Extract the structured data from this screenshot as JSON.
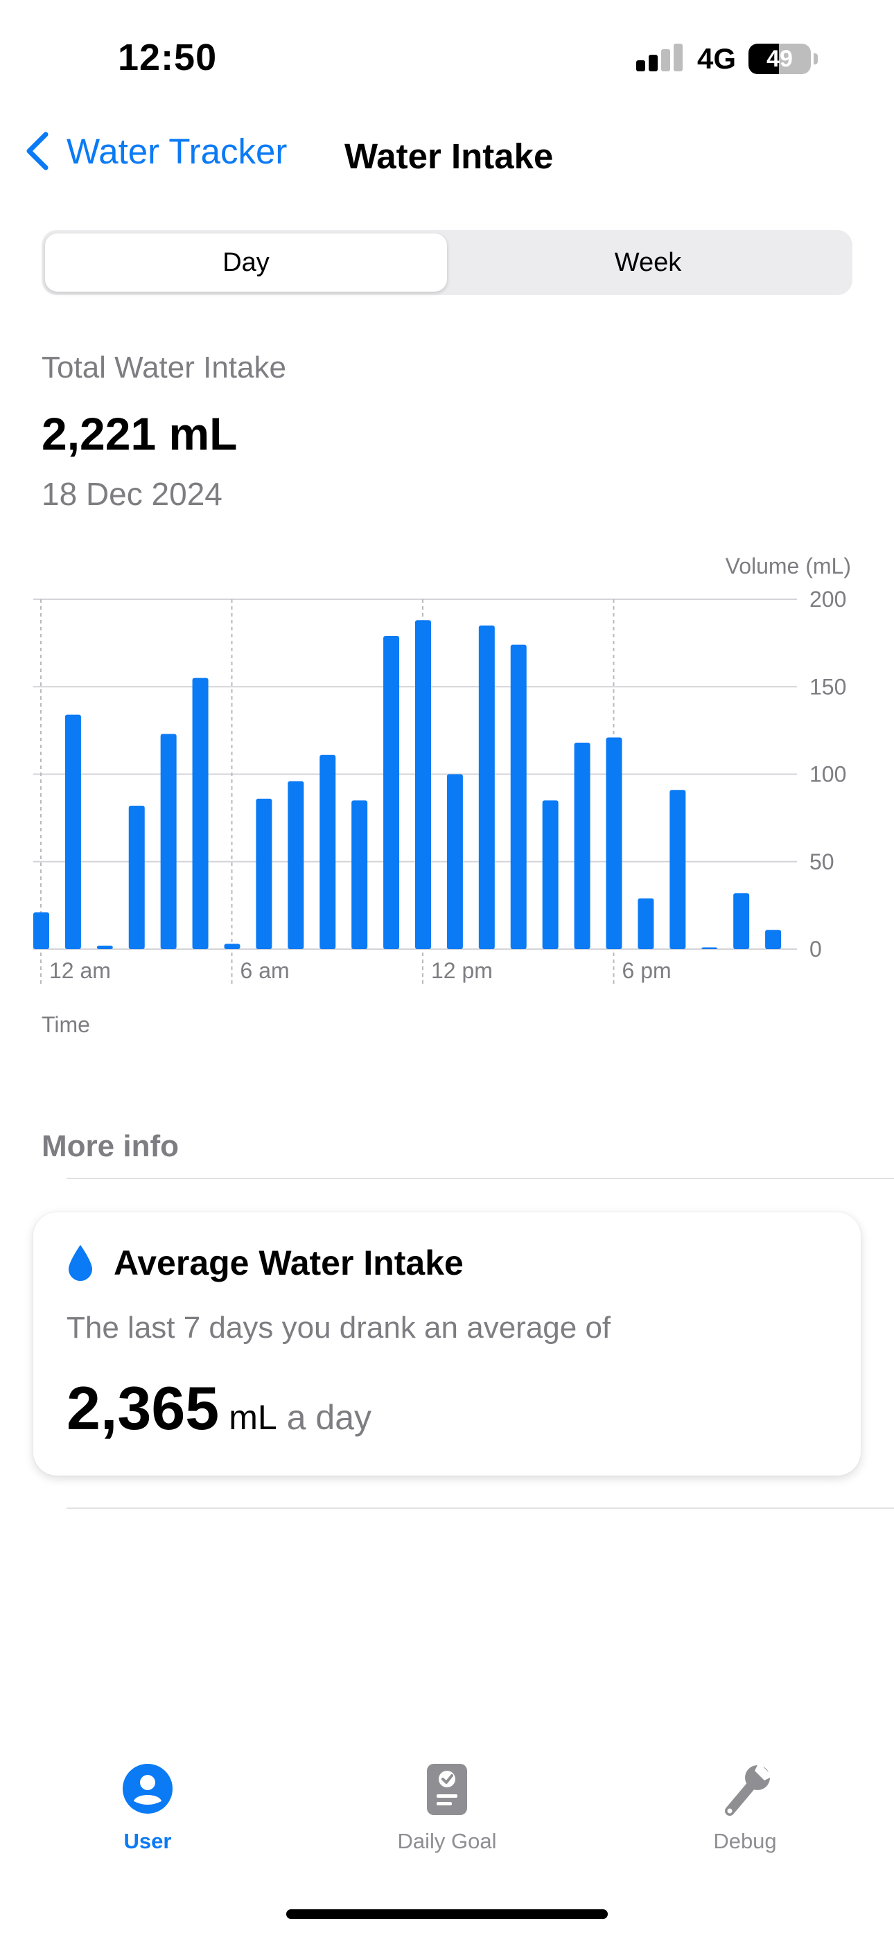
{
  "status_bar": {
    "time": "12:50",
    "network": "4G",
    "battery": "49",
    "battery_level": 0.49
  },
  "nav": {
    "back_label": "Water Tracker",
    "title": "Water Intake"
  },
  "segmented": {
    "options": [
      "Day",
      "Week"
    ],
    "selected": "Day"
  },
  "summary": {
    "label": "Total Water Intake",
    "value": "2,221 mL",
    "date": "18 Dec 2024"
  },
  "chart_data": {
    "type": "bar",
    "ylabel": "Volume (mL)",
    "xlabel": "Time",
    "ylim": [
      0,
      200
    ],
    "yticks": [
      0,
      50,
      100,
      150,
      200
    ],
    "x_tick_labels": [
      "12 am",
      "6 am",
      "12 pm",
      "6 pm"
    ],
    "categories": [
      "0",
      "1",
      "2",
      "3",
      "4",
      "5",
      "6",
      "7",
      "8",
      "9",
      "10",
      "11",
      "12",
      "13",
      "14",
      "15",
      "16",
      "17",
      "18",
      "19",
      "20",
      "21",
      "22",
      "23"
    ],
    "values": [
      21,
      134,
      2,
      82,
      123,
      155,
      3,
      86,
      96,
      111,
      85,
      179,
      188,
      100,
      185,
      174,
      85,
      118,
      121,
      29,
      91,
      1,
      32,
      11
    ],
    "color": "#0a7af5",
    "grid": true
  },
  "more_info": {
    "heading": "More info",
    "card": {
      "icon": "water-drop-icon",
      "title": "Average Water Intake",
      "subtitle": "The last 7 days you drank an average of",
      "value": "2,365",
      "unit": "mL",
      "suffix": "a day"
    }
  },
  "tab_bar": {
    "items": [
      {
        "label": "User",
        "icon": "user-circle-icon",
        "active": true
      },
      {
        "label": "Daily Goal",
        "icon": "clipboard-check-icon",
        "active": false
      },
      {
        "label": "Debug",
        "icon": "wrench-icon",
        "active": false
      }
    ]
  },
  "colors": {
    "accent": "#0a7af5",
    "secondary_text": "#7d7d82"
  }
}
